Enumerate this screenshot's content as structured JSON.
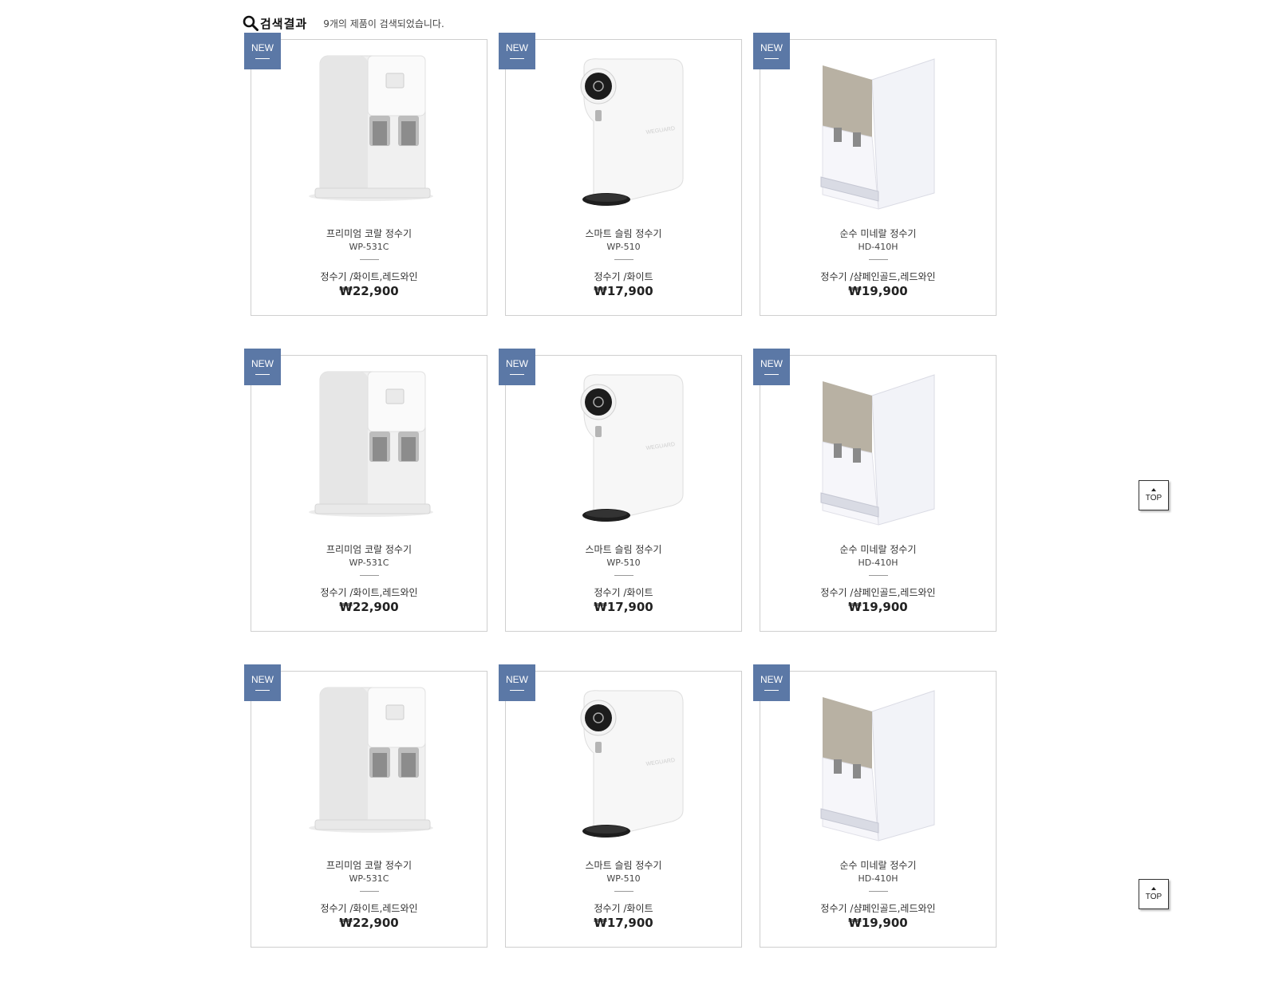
{
  "header": {
    "title": "검색결과",
    "count_text": "9개의 제품이 검색되었습니다."
  },
  "badge_label": "NEW",
  "top_button_label": "TOP",
  "colors": {
    "badge": "#5b78a6",
    "border": "#cfcfcf"
  },
  "products": [
    {
      "name": "프리미엄 코랄 정수기",
      "model": "WP-531C",
      "options": "정수기 /화이트,레드와인",
      "price": "₩22,900",
      "image": "tall-white-purifier"
    },
    {
      "name": "스마트 슬림 정수기",
      "model": "WP-510",
      "options": "정수기 /화이트",
      "price": "₩17,900",
      "image": "slim-round-purifier"
    },
    {
      "name": "순수 미네랄 정수기",
      "model": "HD-410H",
      "options": "정수기 /샴페인골드,레드와인",
      "price": "₩19,900",
      "image": "gold-front-purifier"
    },
    {
      "name": "프리미엄 코랄 정수기",
      "model": "WP-531C",
      "options": "정수기 /화이트,레드와인",
      "price": "₩22,900",
      "image": "tall-white-purifier"
    },
    {
      "name": "스마트 슬림 정수기",
      "model": "WP-510",
      "options": "정수기 /화이트",
      "price": "₩17,900",
      "image": "slim-round-purifier"
    },
    {
      "name": "순수 미네랄 정수기",
      "model": "HD-410H",
      "options": "정수기 /샴페인골드,레드와인",
      "price": "₩19,900",
      "image": "gold-front-purifier"
    },
    {
      "name": "프리미엄 코랄 정수기",
      "model": "WP-531C",
      "options": "정수기 /화이트,레드와인",
      "price": "₩22,900",
      "image": "tall-white-purifier"
    },
    {
      "name": "스마트 슬림 정수기",
      "model": "WP-510",
      "options": "정수기 /화이트",
      "price": "₩17,900",
      "image": "slim-round-purifier"
    },
    {
      "name": "순수 미네랄 정수기",
      "model": "HD-410H",
      "options": "정수기 /샴페인골드,레드와인",
      "price": "₩19,900",
      "image": "gold-front-purifier"
    }
  ]
}
